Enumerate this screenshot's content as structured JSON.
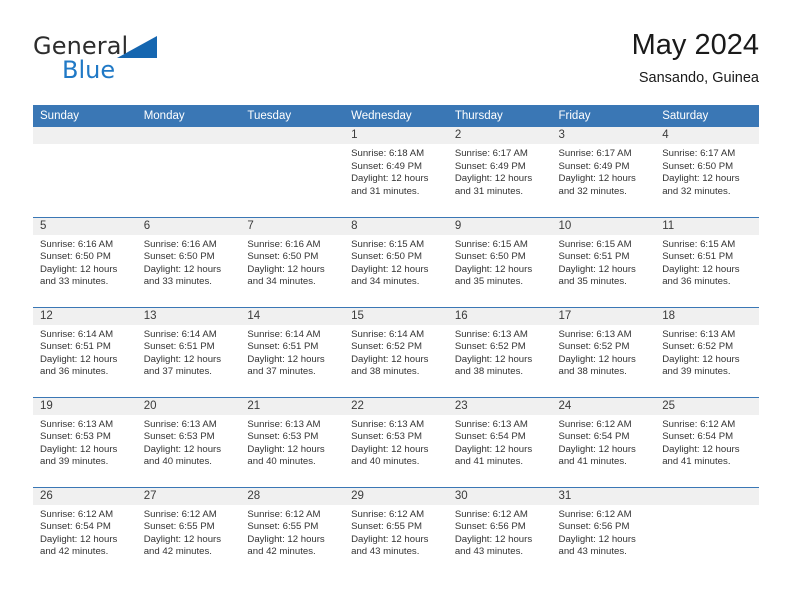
{
  "brand": {
    "name_part1": "General",
    "name_part2": "Blue",
    "logo_icon": "triangle-logo-icon",
    "accent_color": "#1566b0"
  },
  "header": {
    "title": "May 2024",
    "subtitle": "Sansando, Guinea"
  },
  "theme": {
    "header_blue": "#3a77b5",
    "daynum_band": "#f0f0f0",
    "text": "#333333"
  },
  "weekday_headers": [
    "Sunday",
    "Monday",
    "Tuesday",
    "Wednesday",
    "Thursday",
    "Friday",
    "Saturday"
  ],
  "weeks": [
    [
      {
        "day": "",
        "sunrise": "",
        "sunset": "",
        "daylight_line1": "",
        "daylight_line2": ""
      },
      {
        "day": "",
        "sunrise": "",
        "sunset": "",
        "daylight_line1": "",
        "daylight_line2": ""
      },
      {
        "day": "",
        "sunrise": "",
        "sunset": "",
        "daylight_line1": "",
        "daylight_line2": ""
      },
      {
        "day": "1",
        "sunrise": "Sunrise: 6:18 AM",
        "sunset": "Sunset: 6:49 PM",
        "daylight_line1": "Daylight: 12 hours",
        "daylight_line2": "and 31 minutes."
      },
      {
        "day": "2",
        "sunrise": "Sunrise: 6:17 AM",
        "sunset": "Sunset: 6:49 PM",
        "daylight_line1": "Daylight: 12 hours",
        "daylight_line2": "and 31 minutes."
      },
      {
        "day": "3",
        "sunrise": "Sunrise: 6:17 AM",
        "sunset": "Sunset: 6:49 PM",
        "daylight_line1": "Daylight: 12 hours",
        "daylight_line2": "and 32 minutes."
      },
      {
        "day": "4",
        "sunrise": "Sunrise: 6:17 AM",
        "sunset": "Sunset: 6:50 PM",
        "daylight_line1": "Daylight: 12 hours",
        "daylight_line2": "and 32 minutes."
      }
    ],
    [
      {
        "day": "5",
        "sunrise": "Sunrise: 6:16 AM",
        "sunset": "Sunset: 6:50 PM",
        "daylight_line1": "Daylight: 12 hours",
        "daylight_line2": "and 33 minutes."
      },
      {
        "day": "6",
        "sunrise": "Sunrise: 6:16 AM",
        "sunset": "Sunset: 6:50 PM",
        "daylight_line1": "Daylight: 12 hours",
        "daylight_line2": "and 33 minutes."
      },
      {
        "day": "7",
        "sunrise": "Sunrise: 6:16 AM",
        "sunset": "Sunset: 6:50 PM",
        "daylight_line1": "Daylight: 12 hours",
        "daylight_line2": "and 34 minutes."
      },
      {
        "day": "8",
        "sunrise": "Sunrise: 6:15 AM",
        "sunset": "Sunset: 6:50 PM",
        "daylight_line1": "Daylight: 12 hours",
        "daylight_line2": "and 34 minutes."
      },
      {
        "day": "9",
        "sunrise": "Sunrise: 6:15 AM",
        "sunset": "Sunset: 6:50 PM",
        "daylight_line1": "Daylight: 12 hours",
        "daylight_line2": "and 35 minutes."
      },
      {
        "day": "10",
        "sunrise": "Sunrise: 6:15 AM",
        "sunset": "Sunset: 6:51 PM",
        "daylight_line1": "Daylight: 12 hours",
        "daylight_line2": "and 35 minutes."
      },
      {
        "day": "11",
        "sunrise": "Sunrise: 6:15 AM",
        "sunset": "Sunset: 6:51 PM",
        "daylight_line1": "Daylight: 12 hours",
        "daylight_line2": "and 36 minutes."
      }
    ],
    [
      {
        "day": "12",
        "sunrise": "Sunrise: 6:14 AM",
        "sunset": "Sunset: 6:51 PM",
        "daylight_line1": "Daylight: 12 hours",
        "daylight_line2": "and 36 minutes."
      },
      {
        "day": "13",
        "sunrise": "Sunrise: 6:14 AM",
        "sunset": "Sunset: 6:51 PM",
        "daylight_line1": "Daylight: 12 hours",
        "daylight_line2": "and 37 minutes."
      },
      {
        "day": "14",
        "sunrise": "Sunrise: 6:14 AM",
        "sunset": "Sunset: 6:51 PM",
        "daylight_line1": "Daylight: 12 hours",
        "daylight_line2": "and 37 minutes."
      },
      {
        "day": "15",
        "sunrise": "Sunrise: 6:14 AM",
        "sunset": "Sunset: 6:52 PM",
        "daylight_line1": "Daylight: 12 hours",
        "daylight_line2": "and 38 minutes."
      },
      {
        "day": "16",
        "sunrise": "Sunrise: 6:13 AM",
        "sunset": "Sunset: 6:52 PM",
        "daylight_line1": "Daylight: 12 hours",
        "daylight_line2": "and 38 minutes."
      },
      {
        "day": "17",
        "sunrise": "Sunrise: 6:13 AM",
        "sunset": "Sunset: 6:52 PM",
        "daylight_line1": "Daylight: 12 hours",
        "daylight_line2": "and 38 minutes."
      },
      {
        "day": "18",
        "sunrise": "Sunrise: 6:13 AM",
        "sunset": "Sunset: 6:52 PM",
        "daylight_line1": "Daylight: 12 hours",
        "daylight_line2": "and 39 minutes."
      }
    ],
    [
      {
        "day": "19",
        "sunrise": "Sunrise: 6:13 AM",
        "sunset": "Sunset: 6:53 PM",
        "daylight_line1": "Daylight: 12 hours",
        "daylight_line2": "and 39 minutes."
      },
      {
        "day": "20",
        "sunrise": "Sunrise: 6:13 AM",
        "sunset": "Sunset: 6:53 PM",
        "daylight_line1": "Daylight: 12 hours",
        "daylight_line2": "and 40 minutes."
      },
      {
        "day": "21",
        "sunrise": "Sunrise: 6:13 AM",
        "sunset": "Sunset: 6:53 PM",
        "daylight_line1": "Daylight: 12 hours",
        "daylight_line2": "and 40 minutes."
      },
      {
        "day": "22",
        "sunrise": "Sunrise: 6:13 AM",
        "sunset": "Sunset: 6:53 PM",
        "daylight_line1": "Daylight: 12 hours",
        "daylight_line2": "and 40 minutes."
      },
      {
        "day": "23",
        "sunrise": "Sunrise: 6:13 AM",
        "sunset": "Sunset: 6:54 PM",
        "daylight_line1": "Daylight: 12 hours",
        "daylight_line2": "and 41 minutes."
      },
      {
        "day": "24",
        "sunrise": "Sunrise: 6:12 AM",
        "sunset": "Sunset: 6:54 PM",
        "daylight_line1": "Daylight: 12 hours",
        "daylight_line2": "and 41 minutes."
      },
      {
        "day": "25",
        "sunrise": "Sunrise: 6:12 AM",
        "sunset": "Sunset: 6:54 PM",
        "daylight_line1": "Daylight: 12 hours",
        "daylight_line2": "and 41 minutes."
      }
    ],
    [
      {
        "day": "26",
        "sunrise": "Sunrise: 6:12 AM",
        "sunset": "Sunset: 6:54 PM",
        "daylight_line1": "Daylight: 12 hours",
        "daylight_line2": "and 42 minutes."
      },
      {
        "day": "27",
        "sunrise": "Sunrise: 6:12 AM",
        "sunset": "Sunset: 6:55 PM",
        "daylight_line1": "Daylight: 12 hours",
        "daylight_line2": "and 42 minutes."
      },
      {
        "day": "28",
        "sunrise": "Sunrise: 6:12 AM",
        "sunset": "Sunset: 6:55 PM",
        "daylight_line1": "Daylight: 12 hours",
        "daylight_line2": "and 42 minutes."
      },
      {
        "day": "29",
        "sunrise": "Sunrise: 6:12 AM",
        "sunset": "Sunset: 6:55 PM",
        "daylight_line1": "Daylight: 12 hours",
        "daylight_line2": "and 43 minutes."
      },
      {
        "day": "30",
        "sunrise": "Sunrise: 6:12 AM",
        "sunset": "Sunset: 6:56 PM",
        "daylight_line1": "Daylight: 12 hours",
        "daylight_line2": "and 43 minutes."
      },
      {
        "day": "31",
        "sunrise": "Sunrise: 6:12 AM",
        "sunset": "Sunset: 6:56 PM",
        "daylight_line1": "Daylight: 12 hours",
        "daylight_line2": "and 43 minutes."
      },
      {
        "day": "",
        "sunrise": "",
        "sunset": "",
        "daylight_line1": "",
        "daylight_line2": ""
      }
    ]
  ]
}
